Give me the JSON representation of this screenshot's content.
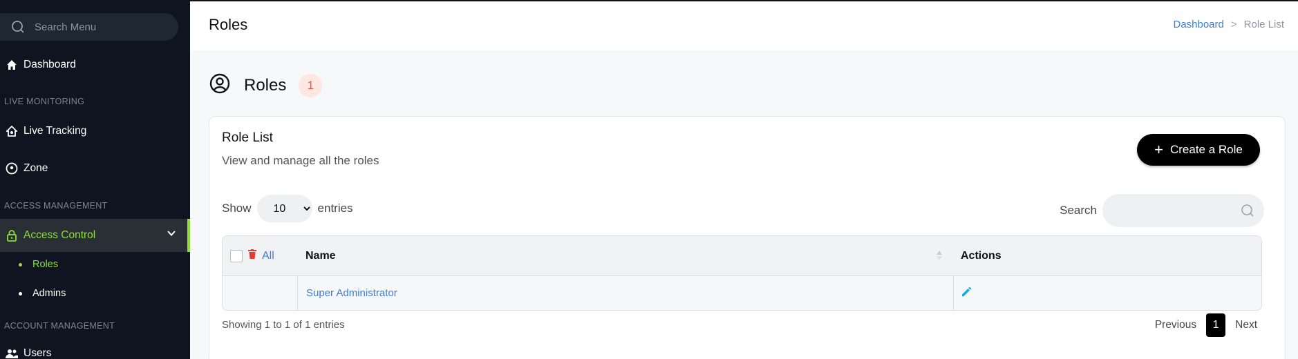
{
  "sidebar": {
    "search_placeholder": "Search Menu",
    "dashboard": "Dashboard",
    "section_live": "LIVE MONITORING",
    "live_tracking": "Live Tracking",
    "zone": "Zone",
    "section_access": "ACCESS MANAGEMENT",
    "access_control": "Access Control",
    "roles": "Roles",
    "admins": "Admins",
    "section_account": "ACCOUNT MANAGEMENT",
    "users": "Users",
    "active_color": "#8ddf3a"
  },
  "topbar": {
    "title": "Roles",
    "breadcrumb": {
      "home": "Dashboard",
      "separator": ">",
      "current": "Role List"
    }
  },
  "page": {
    "heading": "Roles",
    "count": "1"
  },
  "card": {
    "title": "Role List",
    "subtitle": "View and manage all the roles",
    "create_button": "Create a Role",
    "show_label": "Show",
    "entries_label": "entries",
    "page_size": "10",
    "search_label": "Search",
    "columns": {
      "select_all": "All",
      "name": "Name",
      "actions": "Actions"
    },
    "rows": [
      {
        "name": "Super Administrator"
      }
    ],
    "footer_info": "Showing 1 to 1 of 1 entries",
    "pagination": {
      "previous": "Previous",
      "current": "1",
      "next": "Next"
    }
  }
}
